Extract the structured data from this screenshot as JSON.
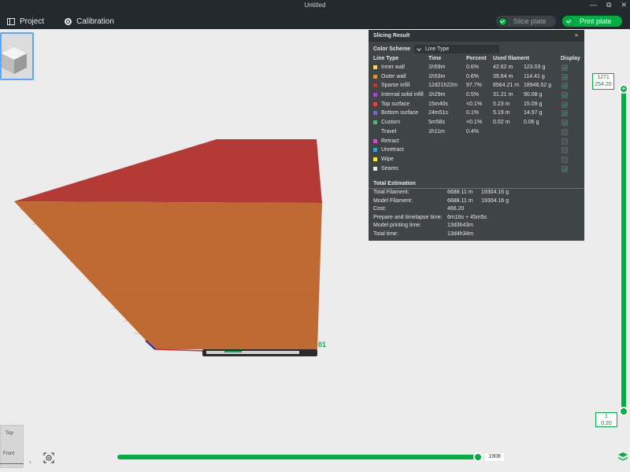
{
  "window": {
    "title": "Untitled",
    "controls": [
      "—",
      "⧉",
      "✕"
    ]
  },
  "menu": {
    "project": "Project",
    "calibration": "Calibration"
  },
  "actions": {
    "slice_plate": "Slice plate",
    "print_plate": "Print plate"
  },
  "plate_label": "01",
  "panel": {
    "title": "Slicing Result",
    "collapse_icon": "≈",
    "color_scheme_label": "Color Scheme",
    "color_scheme_value": "Line Type",
    "headers": {
      "line_type": "Line Type",
      "time": "Time",
      "percent": "Percent",
      "used_filament": "Used filament",
      "display": "Display"
    },
    "rows": [
      {
        "name": "Inner wall",
        "color": "#f5d940",
        "time": "1h59m",
        "percent": "0.6%",
        "length": "42.62 m",
        "weight": "123.03 g",
        "display": true
      },
      {
        "name": "Outer wall",
        "color": "#ff8c00",
        "time": "1h53m",
        "percent": "0.6%",
        "length": "39.64 m",
        "weight": "114.41 g",
        "display": true
      },
      {
        "name": "Sparse infill",
        "color": "#b03a36",
        "time": "12d21h22m",
        "percent": "97.7%",
        "length": "6564.21 m",
        "weight": "18946.52 g",
        "display": true
      },
      {
        "name": "Internal solid infill",
        "color": "#9b4bc9",
        "time": "1h29m",
        "percent": "0.5%",
        "length": "31.21 m",
        "weight": "90.08 g",
        "display": true
      },
      {
        "name": "Top surface",
        "color": "#e8413c",
        "time": "15m40s",
        "percent": "<0.1%",
        "length": "5.23 m",
        "weight": "15.09 g",
        "display": true
      },
      {
        "name": "Bottom surface",
        "color": "#6b6bd8",
        "time": "24m51s",
        "percent": "0.1%",
        "length": "5.19 m",
        "weight": "14.97 g",
        "display": true
      },
      {
        "name": "Custom",
        "color": "#40c070",
        "time": "5m58s",
        "percent": "<0.1%",
        "length": "0.02 m",
        "weight": "0.06 g",
        "display": true
      },
      {
        "name": "Travel",
        "color": "",
        "time": "1h11m",
        "percent": "0.4%",
        "length": "",
        "weight": "",
        "display": false
      },
      {
        "name": "Retract",
        "color": "#e040e0",
        "time": "",
        "percent": "",
        "length": "",
        "weight": "",
        "display": false
      },
      {
        "name": "Unretract",
        "color": "#30a0d8",
        "time": "",
        "percent": "",
        "length": "",
        "weight": "",
        "display": false
      },
      {
        "name": "Wipe",
        "color": "#f0f020",
        "time": "",
        "percent": "",
        "length": "",
        "weight": "",
        "display": false
      },
      {
        "name": "Seams",
        "color": "#e8e8e8",
        "time": "",
        "percent": "",
        "length": "",
        "weight": "",
        "display": true
      }
    ],
    "total_title": "Total Estimation",
    "totals": [
      {
        "label": "Total Filament:",
        "v1": "6688.11 m",
        "v2": "19304.16 g"
      },
      {
        "label": "Model Filament:",
        "v1": "6688.11 m",
        "v2": "19304.16 g"
      },
      {
        "label": "Cost:",
        "v1": "466.20",
        "v2": ""
      },
      {
        "label": "Prepare and timelapse time:",
        "v1": "6m16s + 45m5s",
        "v2": ""
      },
      {
        "label": "Model printing time:",
        "v1": "13d3h43m",
        "v2": ""
      },
      {
        "label": "Total time:",
        "v1": "13d4h34m",
        "v2": ""
      }
    ]
  },
  "layer_slider": {
    "top_layer": "1271",
    "top_height": "254.20",
    "bottom_layer": "1",
    "bottom_height": "0.20",
    "plus_icon": "+"
  },
  "move_slider": {
    "value": "1908"
  },
  "view_cube": {
    "top": "Top",
    "front": "Front"
  },
  "axis_label": "x",
  "colors": {
    "accent": "#00ae42",
    "top_face": "#b33a35",
    "side_face": "#bf6a33"
  }
}
